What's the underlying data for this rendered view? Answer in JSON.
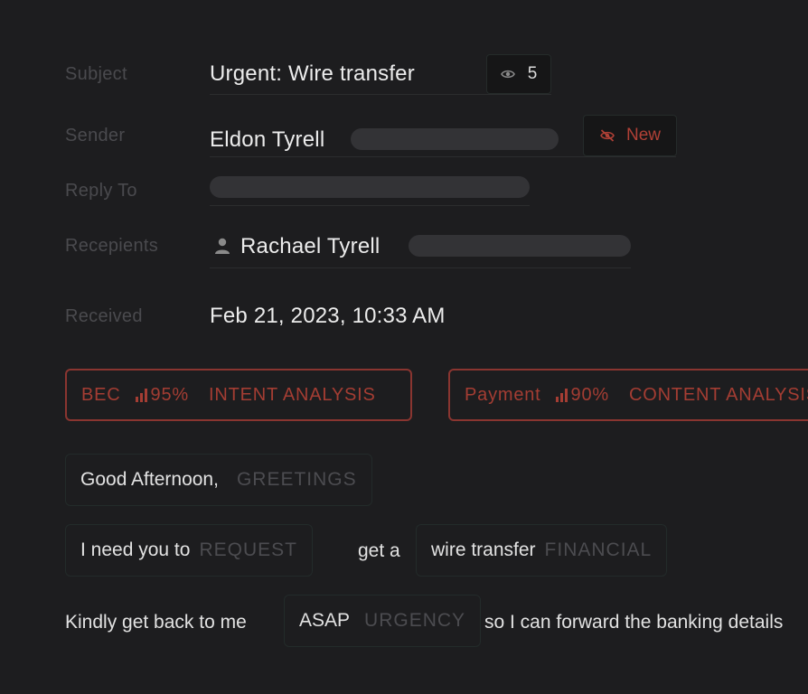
{
  "fields": {
    "subject_label": "Subject",
    "subject_value": "Urgent: Wire transfer",
    "views_count": "5",
    "sender_label": "Sender",
    "sender_name": "Eldon Tyrell",
    "sender_badge": "New",
    "reply_to_label": "Reply To",
    "recipients_label": "Recepients",
    "recipient_name": "Rachael Tyrell",
    "received_label": "Received",
    "received_value": "Feb 21, 2023, 10:33 AM"
  },
  "tags": [
    {
      "type": "BEC",
      "score": "95%",
      "analysis": "INTENT ANALYSIS"
    },
    {
      "type": "Payment",
      "score": "90%",
      "analysis": "CONTENT ANALYSIS"
    }
  ],
  "body": {
    "greeting_text": "Good Afternoon,",
    "greeting_cat": "GREETINGS",
    "request_text": "I need you to",
    "request_cat": "REQUEST",
    "connector_1": "get a",
    "financial_text": "wire transfer",
    "financial_cat": "FINANCIAL",
    "lead_text": "Kindly get back to me",
    "urgency_text": "ASAP",
    "urgency_cat": "URGENCY",
    "tail_text": "so I can forward the banking details"
  },
  "colors": {
    "background": "#1d1d1f",
    "alert_red": "#a43d33",
    "chip_border": "#252b2a"
  },
  "icons": [
    "eye-icon",
    "eye-off-icon",
    "user-icon",
    "bar-chart-icon"
  ]
}
